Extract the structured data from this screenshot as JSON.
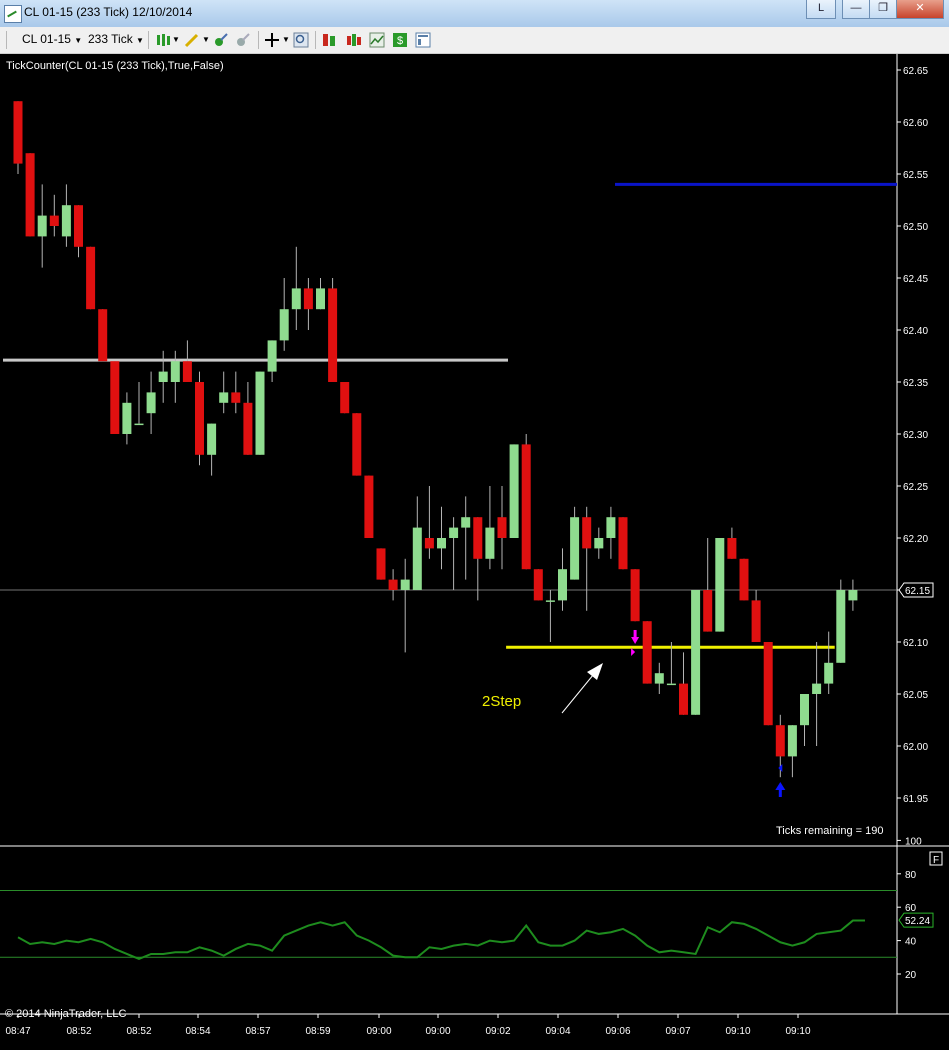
{
  "window": {
    "title": "CL 01-15 (233 Tick)  12/10/2014",
    "controls": [
      "L",
      "minimize",
      "restore",
      "close"
    ]
  },
  "toolbar": {
    "instrument": "CL 01-15",
    "period": "233 Tick",
    "icons": [
      "bar-type-icon",
      "drawing-pencil-icon",
      "signal-icon",
      "crosshair-icon",
      "zoom-icon",
      "orders-icon",
      "strategy-icon",
      "chart-style-icon",
      "dollar-icon",
      "properties-icon"
    ]
  },
  "chart_data": [
    {
      "type": "candlestick",
      "title": "TickCounter(CL 01-15 (233 Tick),True,False)",
      "x_tick_labels": [
        "08:47",
        "08:52",
        "08:52",
        "08:54",
        "08:57",
        "08:59",
        "09:00",
        "09:00",
        "09:02",
        "09:04",
        "09:06",
        "09:07",
        "09:10",
        "09:10"
      ],
      "y_tick_labels": [
        "62.65",
        "62.60",
        "62.55",
        "62.50",
        "62.45",
        "62.40",
        "62.35",
        "62.30",
        "62.25",
        "62.20",
        "62.15",
        "62.10",
        "62.05",
        "62.00",
        "61.95"
      ],
      "ylim": [
        61.93,
        62.66
      ],
      "up_color": "#8fdc8f",
      "down_color": "#e01010",
      "candles": [
        {
          "o": 62.62,
          "h": 62.62,
          "l": 62.55,
          "c": 62.56
        },
        {
          "o": 62.57,
          "h": 62.57,
          "l": 62.49,
          "c": 62.49
        },
        {
          "o": 62.49,
          "h": 62.54,
          "l": 62.46,
          "c": 62.51
        },
        {
          "o": 62.51,
          "h": 62.53,
          "l": 62.49,
          "c": 62.5
        },
        {
          "o": 62.49,
          "h": 62.54,
          "l": 62.48,
          "c": 62.52
        },
        {
          "o": 62.52,
          "h": 62.52,
          "l": 62.47,
          "c": 62.48
        },
        {
          "o": 62.48,
          "h": 62.48,
          "l": 62.42,
          "c": 62.42
        },
        {
          "o": 62.42,
          "h": 62.42,
          "l": 62.37,
          "c": 62.37
        },
        {
          "o": 62.37,
          "h": 62.37,
          "l": 62.3,
          "c": 62.3
        },
        {
          "o": 62.3,
          "h": 62.34,
          "l": 62.29,
          "c": 62.33
        },
        {
          "o": 62.31,
          "h": 62.35,
          "l": 62.31,
          "c": 62.31
        },
        {
          "o": 62.32,
          "h": 62.36,
          "l": 62.3,
          "c": 62.34
        },
        {
          "o": 62.35,
          "h": 62.38,
          "l": 62.33,
          "c": 62.36
        },
        {
          "o": 62.35,
          "h": 62.38,
          "l": 62.33,
          "c": 62.37
        },
        {
          "o": 62.37,
          "h": 62.39,
          "l": 62.35,
          "c": 62.35
        },
        {
          "o": 62.35,
          "h": 62.36,
          "l": 62.27,
          "c": 62.28
        },
        {
          "o": 62.28,
          "h": 62.31,
          "l": 62.26,
          "c": 62.31
        },
        {
          "o": 62.33,
          "h": 62.36,
          "l": 62.32,
          "c": 62.34
        },
        {
          "o": 62.34,
          "h": 62.36,
          "l": 62.32,
          "c": 62.33
        },
        {
          "o": 62.33,
          "h": 62.35,
          "l": 62.28,
          "c": 62.28
        },
        {
          "o": 62.28,
          "h": 62.36,
          "l": 62.28,
          "c": 62.36
        },
        {
          "o": 62.36,
          "h": 62.39,
          "l": 62.35,
          "c": 62.39
        },
        {
          "o": 62.39,
          "h": 62.45,
          "l": 62.38,
          "c": 62.42
        },
        {
          "o": 62.42,
          "h": 62.48,
          "l": 62.4,
          "c": 62.44
        },
        {
          "o": 62.44,
          "h": 62.45,
          "l": 62.4,
          "c": 62.42
        },
        {
          "o": 62.42,
          "h": 62.45,
          "l": 62.42,
          "c": 62.44
        },
        {
          "o": 62.44,
          "h": 62.45,
          "l": 62.35,
          "c": 62.35
        },
        {
          "o": 62.35,
          "h": 62.35,
          "l": 62.32,
          "c": 62.32
        },
        {
          "o": 62.32,
          "h": 62.32,
          "l": 62.26,
          "c": 62.26
        },
        {
          "o": 62.26,
          "h": 62.26,
          "l": 62.2,
          "c": 62.2
        },
        {
          "o": 62.19,
          "h": 62.19,
          "l": 62.16,
          "c": 62.16
        },
        {
          "o": 62.16,
          "h": 62.17,
          "l": 62.14,
          "c": 62.15
        },
        {
          "o": 62.15,
          "h": 62.18,
          "l": 62.09,
          "c": 62.16
        },
        {
          "o": 62.15,
          "h": 62.24,
          "l": 62.15,
          "c": 62.21
        },
        {
          "o": 62.2,
          "h": 62.25,
          "l": 62.18,
          "c": 62.19
        },
        {
          "o": 62.19,
          "h": 62.23,
          "l": 62.17,
          "c": 62.2
        },
        {
          "o": 62.2,
          "h": 62.22,
          "l": 62.15,
          "c": 62.21
        },
        {
          "o": 62.21,
          "h": 62.24,
          "l": 62.16,
          "c": 62.22
        },
        {
          "o": 62.22,
          "h": 62.22,
          "l": 62.14,
          "c": 62.18
        },
        {
          "o": 62.18,
          "h": 62.25,
          "l": 62.17,
          "c": 62.21
        },
        {
          "o": 62.22,
          "h": 62.25,
          "l": 62.17,
          "c": 62.2
        },
        {
          "o": 62.2,
          "h": 62.29,
          "l": 62.2,
          "c": 62.29
        },
        {
          "o": 62.29,
          "h": 62.3,
          "l": 62.17,
          "c": 62.17
        },
        {
          "o": 62.17,
          "h": 62.17,
          "l": 62.14,
          "c": 62.14
        },
        {
          "o": 62.14,
          "h": 62.15,
          "l": 62.1,
          "c": 62.14
        },
        {
          "o": 62.14,
          "h": 62.19,
          "l": 62.13,
          "c": 62.17
        },
        {
          "o": 62.16,
          "h": 62.23,
          "l": 62.16,
          "c": 62.22
        },
        {
          "o": 62.22,
          "h": 62.23,
          "l": 62.13,
          "c": 62.19
        },
        {
          "o": 62.19,
          "h": 62.21,
          "l": 62.18,
          "c": 62.2
        },
        {
          "o": 62.2,
          "h": 62.23,
          "l": 62.18,
          "c": 62.22
        },
        {
          "o": 62.22,
          "h": 62.22,
          "l": 62.17,
          "c": 62.17
        },
        {
          "o": 62.17,
          "h": 62.17,
          "l": 62.12,
          "c": 62.12
        },
        {
          "o": 62.12,
          "h": 62.12,
          "l": 62.06,
          "c": 62.06
        },
        {
          "o": 62.06,
          "h": 62.08,
          "l": 62.05,
          "c": 62.07
        },
        {
          "o": 62.06,
          "h": 62.1,
          "l": 62.06,
          "c": 62.06
        },
        {
          "o": 62.06,
          "h": 62.09,
          "l": 62.03,
          "c": 62.03
        },
        {
          "o": 62.03,
          "h": 62.15,
          "l": 62.03,
          "c": 62.15
        },
        {
          "o": 62.15,
          "h": 62.2,
          "l": 62.11,
          "c": 62.11
        },
        {
          "o": 62.11,
          "h": 62.2,
          "l": 62.11,
          "c": 62.2
        },
        {
          "o": 62.2,
          "h": 62.21,
          "l": 62.18,
          "c": 62.18
        },
        {
          "o": 62.18,
          "h": 62.18,
          "l": 62.14,
          "c": 62.14
        },
        {
          "o": 62.14,
          "h": 62.15,
          "l": 62.1,
          "c": 62.1
        },
        {
          "o": 62.1,
          "h": 62.1,
          "l": 62.02,
          "c": 62.02
        },
        {
          "o": 62.02,
          "h": 62.03,
          "l": 61.97,
          "c": 61.99
        },
        {
          "o": 61.99,
          "h": 62.02,
          "l": 61.97,
          "c": 62.02
        },
        {
          "o": 62.02,
          "h": 62.05,
          "l": 62.0,
          "c": 62.05
        },
        {
          "o": 62.05,
          "h": 62.1,
          "l": 62.0,
          "c": 62.06
        },
        {
          "o": 62.06,
          "h": 62.11,
          "l": 62.05,
          "c": 62.08
        },
        {
          "o": 62.08,
          "h": 62.16,
          "l": 62.08,
          "c": 62.15
        },
        {
          "o": 62.14,
          "h": 62.16,
          "l": 62.13,
          "c": 62.15
        }
      ],
      "horizontal_lines": [
        {
          "price": 62.54,
          "color": "#0a14c8",
          "from_bar": 50
        },
        {
          "price": 62.371,
          "color": "#c8c8c8",
          "from_bar": 0,
          "to_bar": 40
        },
        {
          "price": 62.095,
          "color": "#f0f000",
          "from_bar": 41,
          "to_bar": 67
        }
      ],
      "current_price": {
        "label": "62.15",
        "value": 62.15
      },
      "annotation": {
        "text": "2Step",
        "color": "#f0f000"
      },
      "status_text": "Ticks remaining = 190",
      "markers": [
        {
          "bar": 51,
          "direction": "down",
          "color": "#ff00ff"
        },
        {
          "bar": 63,
          "direction": "up",
          "color": "#0a14ff"
        }
      ]
    },
    {
      "type": "line",
      "y_tick_labels": [
        "100",
        "80",
        "60",
        "40",
        "20"
      ],
      "ylim": [
        10,
        103
      ],
      "reference_lines": [
        70,
        30
      ],
      "line_color": "#1e8c1e",
      "current_value": {
        "label": "52.24",
        "value": 52.24
      },
      "values": [
        42,
        38,
        39,
        38,
        40,
        39,
        41,
        39,
        35,
        32,
        29,
        32,
        32,
        33,
        33,
        36,
        34,
        31,
        35,
        38,
        37,
        34,
        43,
        46,
        49,
        51,
        49,
        51,
        43,
        40,
        36,
        31,
        30,
        30,
        36,
        35,
        37,
        38,
        37,
        40,
        39,
        40,
        49,
        39,
        37,
        37,
        40,
        46,
        44,
        45,
        47,
        43,
        37,
        33,
        34,
        33,
        32,
        48,
        45,
        51,
        50,
        47,
        43,
        39,
        37,
        39,
        44,
        45,
        46,
        52,
        52
      ]
    }
  ],
  "footer": {
    "copyright": "© 2014 NinjaTrader, LLC",
    "panel_flag": "F"
  }
}
